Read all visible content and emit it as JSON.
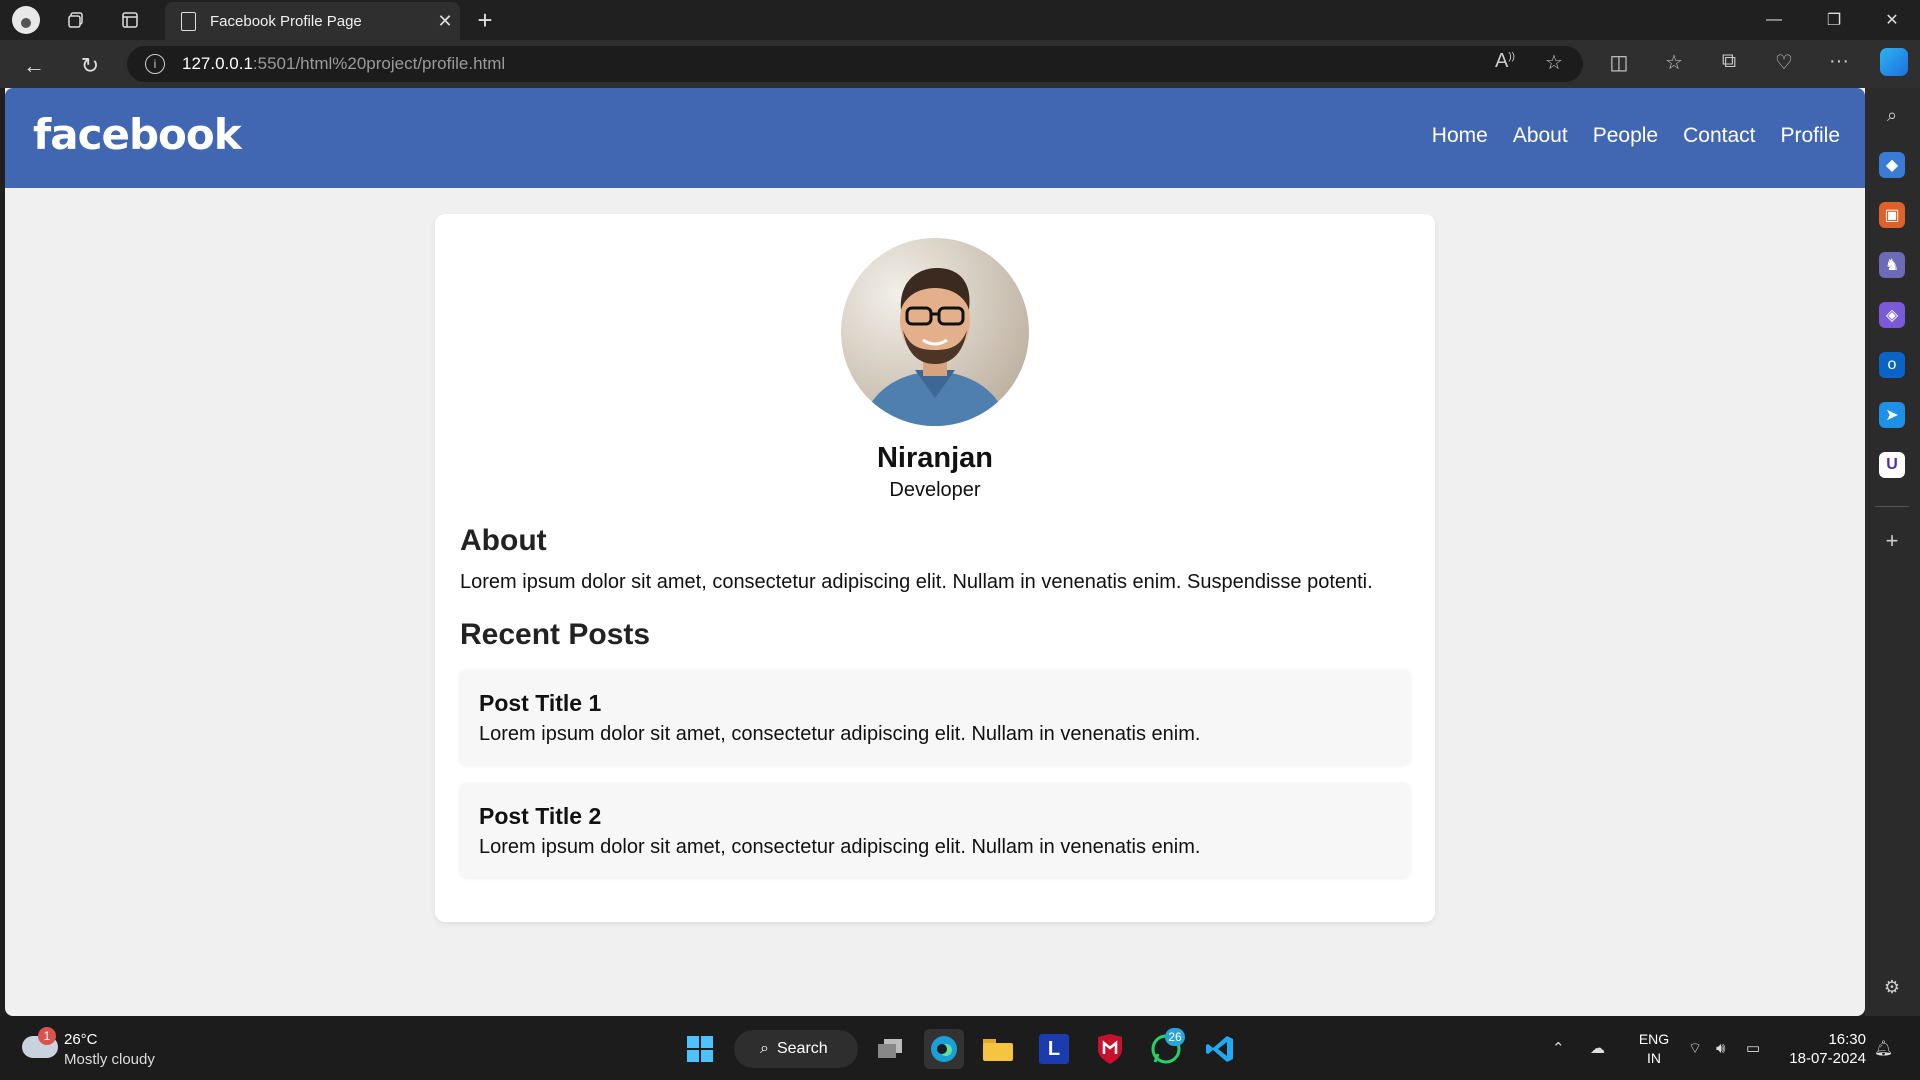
{
  "browser": {
    "tab_title": "Facebook Profile Page",
    "url_host": "127.0.0.1",
    "url_rest": ":5501/html%20project/profile.html"
  },
  "site": {
    "logo": "facebook",
    "nav": [
      "Home",
      "About",
      "People",
      "Contact",
      "Profile"
    ],
    "colors": {
      "header": "#4267b2",
      "page_bg": "#f0f0f0"
    }
  },
  "profile": {
    "name": "Niranjan",
    "role": "Developer",
    "about_heading": "About",
    "about_text": "Lorem ipsum dolor sit amet, consectetur adipiscing elit. Nullam in venenatis enim. Suspendisse potenti.",
    "posts_heading": "Recent Posts",
    "posts": [
      {
        "title": "Post Title 1",
        "body": "Lorem ipsum dolor sit amet, consectetur adipiscing elit. Nullam in venenatis enim."
      },
      {
        "title": "Post Title 2",
        "body": "Lorem ipsum dolor sit amet, consectetur adipiscing elit. Nullam in venenatis enim."
      }
    ]
  },
  "taskbar": {
    "weather_badge": "1",
    "temperature": "26°C",
    "condition": "Mostly cloudy",
    "search_label": "Search",
    "whatsapp_badge": "26",
    "lang_top": "ENG",
    "lang_bottom": "IN",
    "time": "16:30",
    "date": "18-07-2024"
  }
}
